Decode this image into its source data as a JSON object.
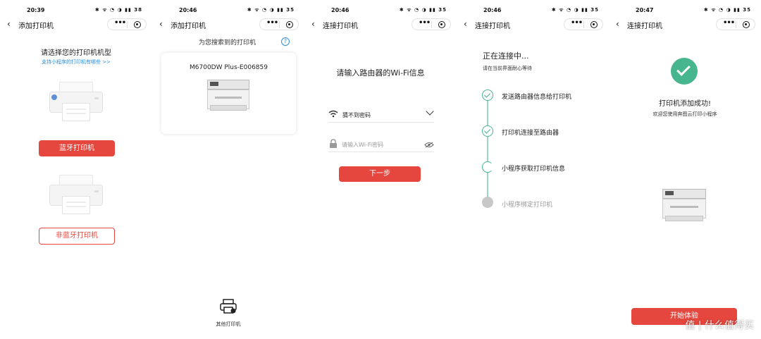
{
  "panels": [
    {
      "time": "20:39",
      "status_icons": "✱ ᯤ ◔ ◑ ▮▮ 38",
      "title": "添加打印机",
      "heading": "请选择您的打印机机型",
      "link": "支持小程序的打印机有哪些 >>",
      "bt_button": "蓝牙打印机",
      "non_bt_button": "非蓝牙打印机"
    },
    {
      "time": "20:46",
      "status_icons": "✱ ᯤ ◔ ◑ ▮▮ 35",
      "title": "添加打印机",
      "heading": "为您搜索到的打印机",
      "help": "?",
      "printer_name": "M6700DW Plus-E006859",
      "other_printer": "其他打印机"
    },
    {
      "time": "20:46",
      "status_icons": "✱ ᯤ ◔ ◑ ▮▮ 35",
      "title": "连接打印机",
      "heading": "请输入路由器的Wi-Fi信息",
      "wifi_value": "猜不到密码",
      "password_placeholder": "请输入Wi-Fi密码",
      "next_button": "下一步"
    },
    {
      "time": "20:46",
      "status_icons": "✱ ᯤ ◔ ◑ ▮▮ 35",
      "title": "连接打印机",
      "heading": "正在连接中...",
      "subheading": "请在当前界面耐心等待",
      "steps": [
        "发送路由器信息给打印机",
        "打印机连接至路由器",
        "小程序获取打印机信息",
        "小程序绑定打印机"
      ]
    },
    {
      "time": "20:47",
      "status_icons": "✱ ᯤ ◔ ◑ ▮▮ 35",
      "title": "连接打印机",
      "heading": "打印机添加成功!",
      "subheading": "欢迎您使用奔图云打印小程序",
      "start_button": "开始体验"
    }
  ],
  "watermark": "值 | 什么值得买",
  "colors": {
    "accent_red": "#e5473e",
    "link_blue": "#2e8fdc",
    "success_green": "#47b58e",
    "step_line": "#9ed3c5"
  },
  "icons": [
    "chevron-left-icon",
    "more-dots-icon",
    "target-icon",
    "question-icon",
    "wifi-icon",
    "chevron-down-icon",
    "lock-icon",
    "eye-icon",
    "check-icon",
    "printer-icon"
  ]
}
